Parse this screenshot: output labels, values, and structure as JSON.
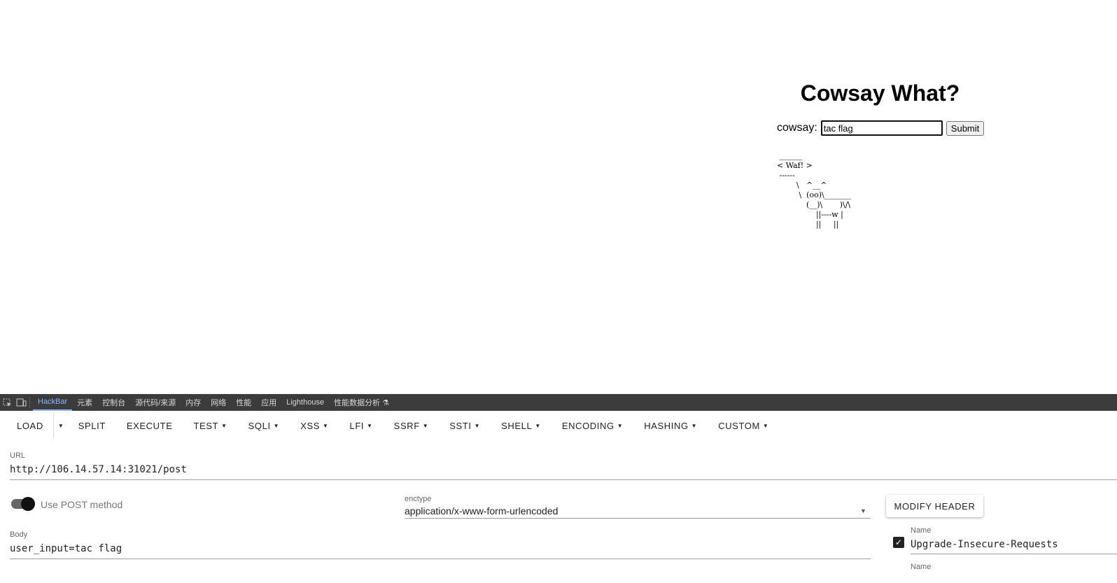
{
  "page": {
    "title": "Cowsay What?",
    "form_label": "cowsay:",
    "input_value": "tac flag",
    "submit_label": "Submit",
    "output": " ______\n< Waf! >\n ------\n        \\   ^__^\n         \\  (oo)\\_______\n            (__)\\       )\\/\\\n                ||----w |\n                ||     ||"
  },
  "devtools": {
    "tabs": [
      "HackBar",
      "元素",
      "控制台",
      "源代码/来源",
      "内存",
      "网络",
      "性能",
      "应用",
      "Lighthouse",
      "性能数据分析 ⚗"
    ],
    "active_tab": "HackBar",
    "icons": [
      "inspect-icon",
      "device-toolbar-icon"
    ]
  },
  "hackbar": {
    "toolbar": {
      "load": "LOAD",
      "split": "SPLIT",
      "execute": "EXECUTE",
      "test": "TEST",
      "sqli": "SQLI",
      "xss": "XSS",
      "lfi": "LFI",
      "ssrf": "SSRF",
      "ssti": "SSTI",
      "shell": "SHELL",
      "encoding": "ENCODING",
      "hashing": "HASHING",
      "custom": "CUSTOM"
    },
    "url_label": "URL",
    "url": "http://106.14.57.14:31021/post",
    "post_method_label": "Use POST method",
    "post_method_enabled": true,
    "enctype_label": "enctype",
    "enctype": "application/x-www-form-urlencoded",
    "body_label": "Body",
    "body": "user_input=tac flag",
    "modify_header_label": "MODIFY HEADER",
    "headers": [
      {
        "name_label": "Name",
        "name": "Upgrade-Insecure-Requests",
        "enabled": true
      },
      {
        "name_label": "Name",
        "name": "",
        "enabled": true
      }
    ]
  }
}
